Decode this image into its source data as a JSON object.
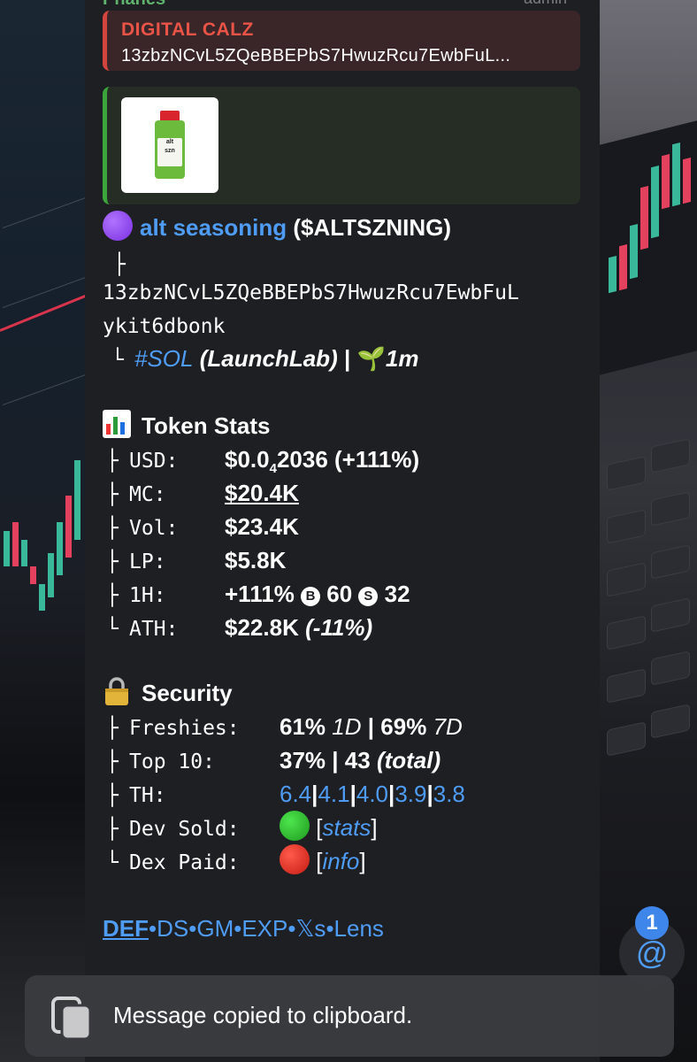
{
  "header": {
    "sender": "Phanes",
    "role": "admin"
  },
  "reply": {
    "title": "DIGITAL CALZ",
    "text": "13zbzNCvL5ZQeBBEPbS7HwuzRcu7EwbFuL..."
  },
  "preview": {
    "image": "alt seasoning jar"
  },
  "token": {
    "name": "alt seasoning",
    "ticker": "($ALTSZNING)",
    "address_line1": "13zbzNCvL5ZQeBBEPbS7HwuzRcu7EwbFuL",
    "address_line2": "ykit6dbonk",
    "chain": "#SOL",
    "launchpad": "(LaunchLab)",
    "separator": "|",
    "age": "1m"
  },
  "token_stats": {
    "title": "Token Stats",
    "usd_label": "USD:",
    "usd_prefix": "$0.0",
    "usd_subscript": "4",
    "usd_suffix": "2036 (+111%)",
    "mc_label": "MC:",
    "mc_value": "$20.4K",
    "vol_label": "Vol:",
    "vol_value": "$23.4K",
    "lp_label": "LP:",
    "lp_value": "$5.8K",
    "h1_label": "1H:",
    "h1_change": "+111%",
    "h1_buys_icon": "B",
    "h1_buys": "60",
    "h1_sells_icon": "S",
    "h1_sells": "32",
    "ath_label": "ATH:",
    "ath_value": "$22.8K",
    "ath_change": "(-11%)"
  },
  "security": {
    "title": "Security",
    "freshies_label": "Freshies:",
    "freshies_1d": "61%",
    "freshies_1d_unit": "1D",
    "freshies_7d": "69%",
    "freshies_7d_unit": "7D",
    "top10_label": "Top 10:",
    "top10_pct": "37%",
    "top10_count": "43",
    "top10_total": "(total)",
    "th_label": "TH:",
    "th_values": [
      "6.4",
      "4.1",
      "4.0",
      "3.9",
      "3.8"
    ],
    "dev_sold_label": "Dev Sold:",
    "dev_sold_link": "stats",
    "dex_paid_label": "Dex Paid:",
    "dex_paid_link": "info",
    "pipe": "|",
    "bracket_open": "[",
    "bracket_close": "]"
  },
  "links": {
    "def": "DEF",
    "ds": "DS",
    "gm": "GM",
    "exp": "EXP",
    "xs": "𝕏s",
    "lens": "Lens",
    "dot": "•"
  },
  "mentions": {
    "badge_count": "1",
    "symbol": "@"
  },
  "toast": {
    "message": "Message copied to clipboard."
  },
  "colors": {
    "link": "#4f9cf5",
    "panel_bg": "#1e1f23",
    "reply_accent": "#d2453f",
    "preview_accent": "#3ba43b"
  }
}
